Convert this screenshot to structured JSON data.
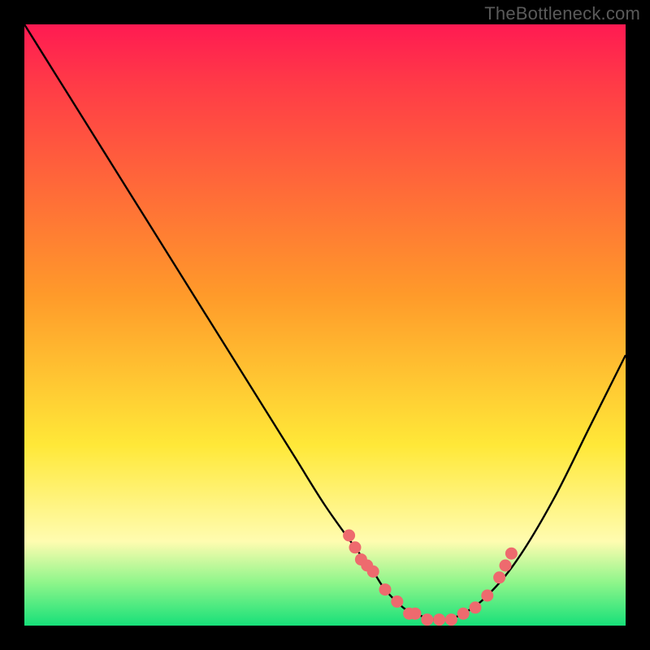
{
  "watermark": "TheBottleneck.com",
  "colors": {
    "top": "#ff1a52",
    "red": "#ff3b47",
    "orange": "#ff9a2a",
    "yellow": "#ffe838",
    "paleyellow": "#fffcb0",
    "lightgreen": "#8cf58a",
    "green": "#17e079",
    "dot": "#ee6a6e",
    "curve": "#000000"
  },
  "chart_data": {
    "type": "line",
    "title": "",
    "xlabel": "",
    "ylabel": "",
    "xlim": [
      0,
      100
    ],
    "ylim": [
      0,
      100
    ],
    "series": [
      {
        "name": "bottleneck-curve",
        "x": [
          0,
          5,
          10,
          15,
          20,
          25,
          30,
          35,
          40,
          45,
          50,
          55,
          58,
          60,
          63,
          65,
          68,
          70,
          73,
          77,
          82,
          88,
          94,
          100
        ],
        "y": [
          100,
          92,
          84,
          76,
          68,
          60,
          52,
          44,
          36,
          28,
          20,
          13,
          9,
          6,
          3,
          2,
          1,
          1,
          2,
          5,
          11,
          21,
          33,
          45
        ]
      }
    ],
    "scatter": [
      {
        "name": "highlight-dots",
        "x": [
          54,
          55,
          56,
          57,
          58,
          60,
          62,
          64,
          65,
          67,
          69,
          71,
          73,
          75,
          77,
          79,
          80,
          81
        ],
        "y": [
          15,
          13,
          11,
          10,
          9,
          6,
          4,
          2,
          2,
          1,
          1,
          1,
          2,
          3,
          5,
          8,
          10,
          12
        ]
      }
    ],
    "gradient_stops": [
      {
        "pct": 0,
        "key": "top"
      },
      {
        "pct": 10,
        "key": "red"
      },
      {
        "pct": 45,
        "key": "orange"
      },
      {
        "pct": 70,
        "key": "yellow"
      },
      {
        "pct": 86,
        "key": "paleyellow"
      },
      {
        "pct": 93,
        "key": "lightgreen"
      },
      {
        "pct": 100,
        "key": "green"
      }
    ]
  }
}
